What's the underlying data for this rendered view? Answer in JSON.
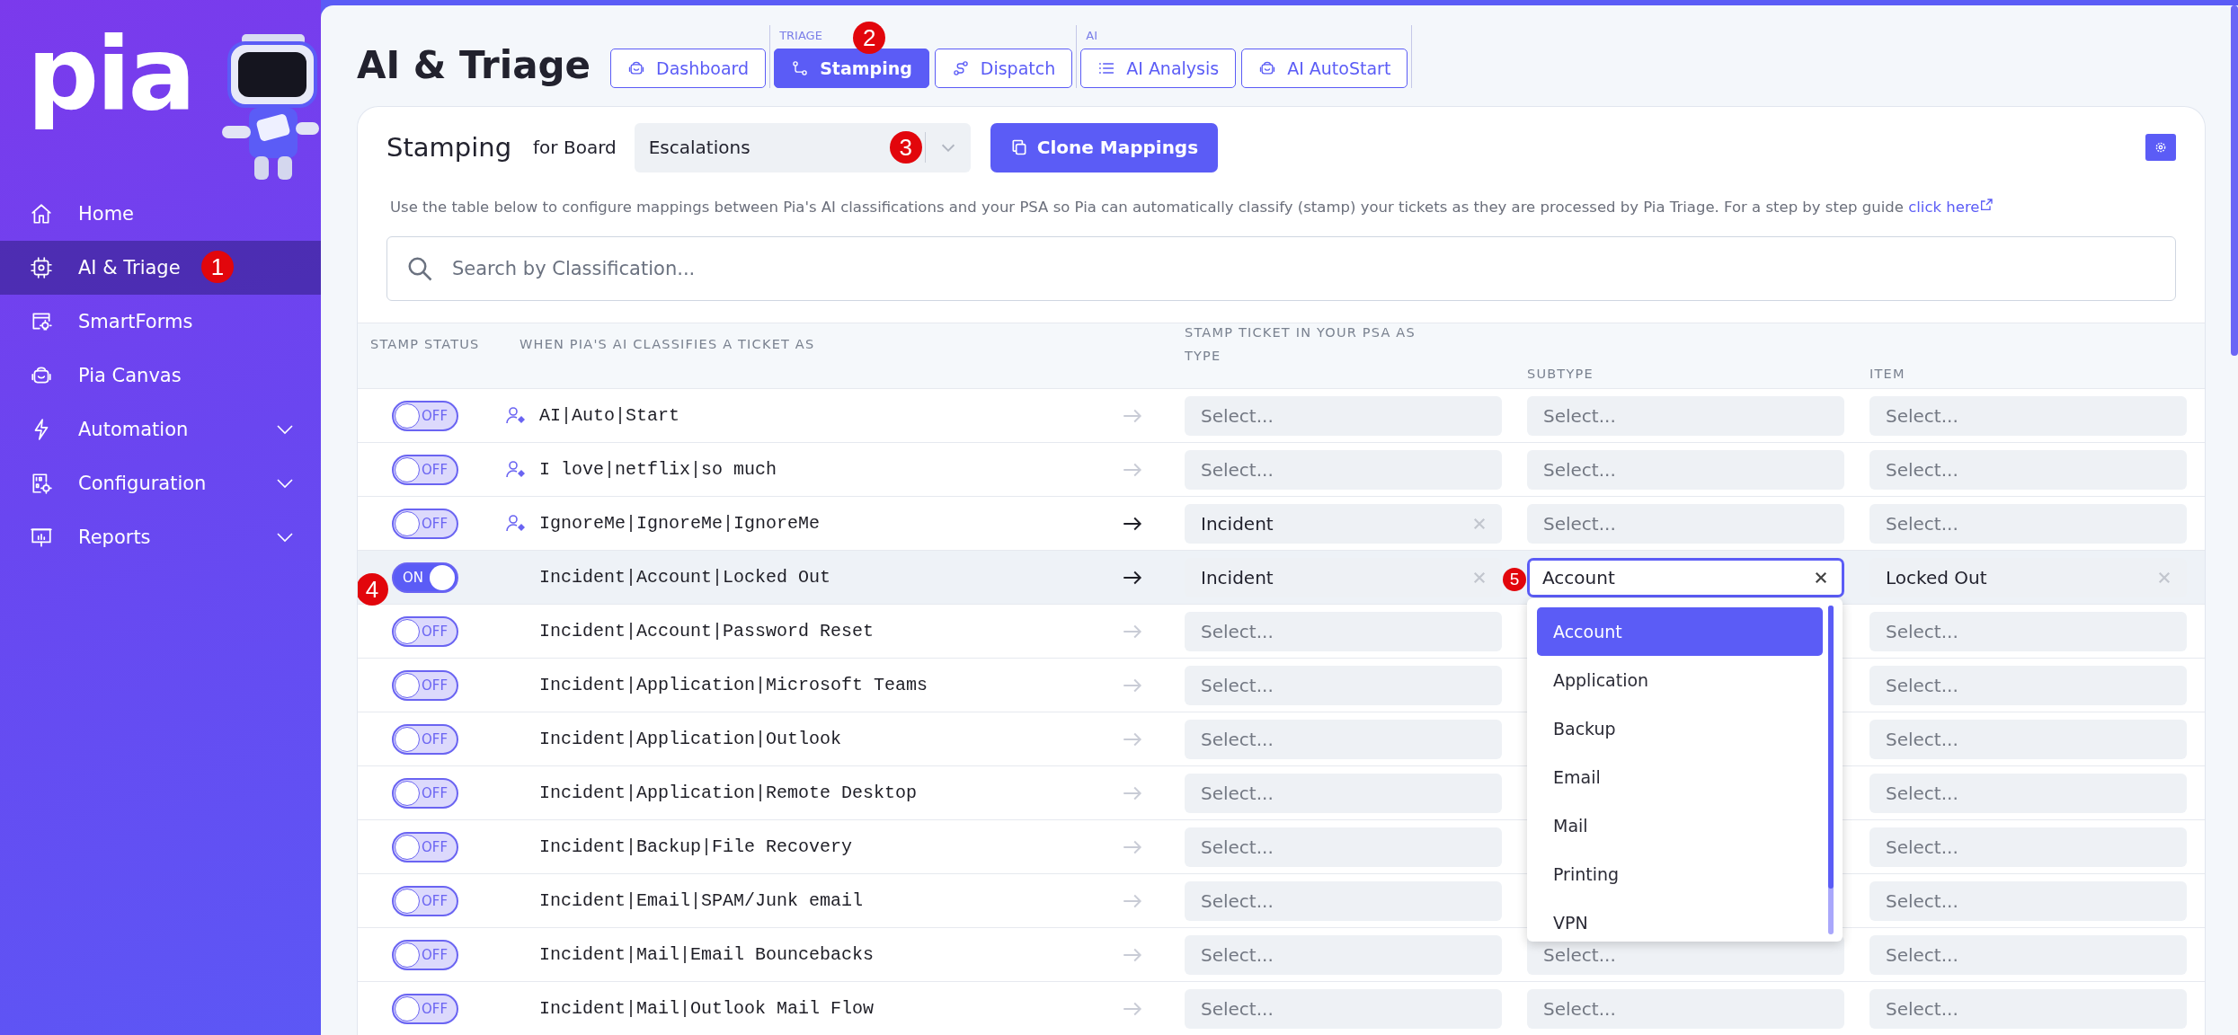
{
  "sidebar": {
    "logo": "pia",
    "items": [
      {
        "label": "Home",
        "selected": false,
        "expandable": false
      },
      {
        "label": "AI & Triage",
        "selected": true,
        "expandable": false,
        "callout": "1"
      },
      {
        "label": "SmartForms",
        "selected": false,
        "expandable": false
      },
      {
        "label": "Pia Canvas",
        "selected": false,
        "expandable": false
      },
      {
        "label": "Automation",
        "selected": false,
        "expandable": true
      },
      {
        "label": "Configuration",
        "selected": false,
        "expandable": true
      },
      {
        "label": "Reports",
        "selected": false,
        "expandable": true
      }
    ]
  },
  "header": {
    "title": "AI & Triage",
    "nav_groups": [
      {
        "tabs": [
          {
            "label": "Dashboard",
            "selected": false
          }
        ]
      },
      {
        "label": "TRIAGE",
        "callout": "2",
        "tabs": [
          {
            "label": "Stamping",
            "selected": true
          },
          {
            "label": "Dispatch",
            "selected": false
          }
        ]
      },
      {
        "label": "AI",
        "tabs": [
          {
            "label": "AI Analysis",
            "selected": false
          },
          {
            "label": "AI AutoStart",
            "selected": false
          }
        ]
      }
    ]
  },
  "card": {
    "title": "Stamping",
    "board_label": "for Board",
    "board_select": {
      "value": "Escalations",
      "callout": "3"
    },
    "clone_button": "Clone Mappings",
    "description": "Use the table below to configure mappings between Pia's AI classifications and your PSA so Pia can automatically classify (stamp) your tickets as they are processed by Pia Triage. For a step by step guide ",
    "link": "click here",
    "search": {
      "placeholder": "Search by Classification..."
    },
    "table": {
      "columns": {
        "status": "STAMP STATUS",
        "classification": "WHEN PIA'S AI CLASSIFIES A TICKET AS",
        "psa_group": "STAMP TICKET IN YOUR PSA AS",
        "type": "TYPE",
        "subtype": "SUBTYPE",
        "item": "ITEM"
      },
      "rows": [
        {
          "on": false,
          "toggle_label": "OFF",
          "user_icon": true,
          "classification": "AI|Auto|Start",
          "type": {
            "placeholder": "Select..."
          },
          "subtype": {
            "placeholder": "Select..."
          },
          "item": {
            "placeholder": "Select..."
          }
        },
        {
          "on": false,
          "toggle_label": "OFF",
          "user_icon": true,
          "classification": "I love|netflix|so much",
          "type": {
            "placeholder": "Select..."
          },
          "subtype": {
            "placeholder": "Select..."
          },
          "item": {
            "placeholder": "Select..."
          }
        },
        {
          "on": false,
          "toggle_label": "OFF",
          "user_icon": true,
          "classification": "IgnoreMe|IgnoreMe|IgnoreMe",
          "type": {
            "value": "Incident"
          },
          "subtype": {
            "placeholder": "Select..."
          },
          "item": {
            "placeholder": "Select..."
          }
        },
        {
          "on": true,
          "toggle_label": "ON",
          "user_icon": false,
          "hovered": true,
          "callout": "4",
          "classification": "Incident|Account|Locked Out",
          "type": {
            "value": "Incident"
          },
          "subtype": {
            "value": "Account",
            "focused": true,
            "callout": "5",
            "options": [
              {
                "label": "Account",
                "selected": true
              },
              {
                "label": "Application",
                "selected": false
              },
              {
                "label": "Backup",
                "selected": false
              },
              {
                "label": "Email",
                "selected": false
              },
              {
                "label": "Mail",
                "selected": false
              },
              {
                "label": "Printing",
                "selected": false
              },
              {
                "label": "VPN",
                "selected": false
              }
            ]
          },
          "item": {
            "value": "Locked Out"
          }
        },
        {
          "on": false,
          "toggle_label": "OFF",
          "user_icon": false,
          "classification": "Incident|Account|Password Reset",
          "type": {
            "placeholder": "Select..."
          },
          "item": {
            "placeholder": "Select..."
          }
        },
        {
          "on": false,
          "toggle_label": "OFF",
          "user_icon": false,
          "classification": "Incident|Application|Microsoft Teams",
          "type": {
            "placeholder": "Select..."
          },
          "item": {
            "placeholder": "Select..."
          }
        },
        {
          "on": false,
          "toggle_label": "OFF",
          "user_icon": false,
          "classification": "Incident|Application|Outlook",
          "type": {
            "placeholder": "Select..."
          },
          "item": {
            "placeholder": "Select..."
          }
        },
        {
          "on": false,
          "toggle_label": "OFF",
          "user_icon": false,
          "classification": "Incident|Application|Remote Desktop",
          "type": {
            "placeholder": "Select..."
          },
          "item": {
            "placeholder": "Select..."
          }
        },
        {
          "on": false,
          "toggle_label": "OFF",
          "user_icon": false,
          "classification": "Incident|Backup|File Recovery",
          "type": {
            "placeholder": "Select..."
          },
          "item": {
            "placeholder": "Select..."
          }
        },
        {
          "on": false,
          "toggle_label": "OFF",
          "user_icon": false,
          "classification": "Incident|Email|SPAM/Junk email",
          "type": {
            "placeholder": "Select..."
          },
          "item": {
            "placeholder": "Select..."
          }
        },
        {
          "on": false,
          "toggle_label": "OFF",
          "user_icon": false,
          "classification": "Incident|Mail|Email Bouncebacks",
          "type": {
            "placeholder": "Select..."
          },
          "subtype": {
            "placeholder": "Select..."
          },
          "item": {
            "placeholder": "Select..."
          }
        },
        {
          "on": false,
          "toggle_label": "OFF",
          "user_icon": false,
          "classification": "Incident|Mail|Outlook Mail Flow",
          "type": {
            "placeholder": "Select..."
          },
          "subtype": {
            "placeholder": "Select..."
          },
          "item": {
            "placeholder": "Select..."
          }
        }
      ]
    }
  }
}
